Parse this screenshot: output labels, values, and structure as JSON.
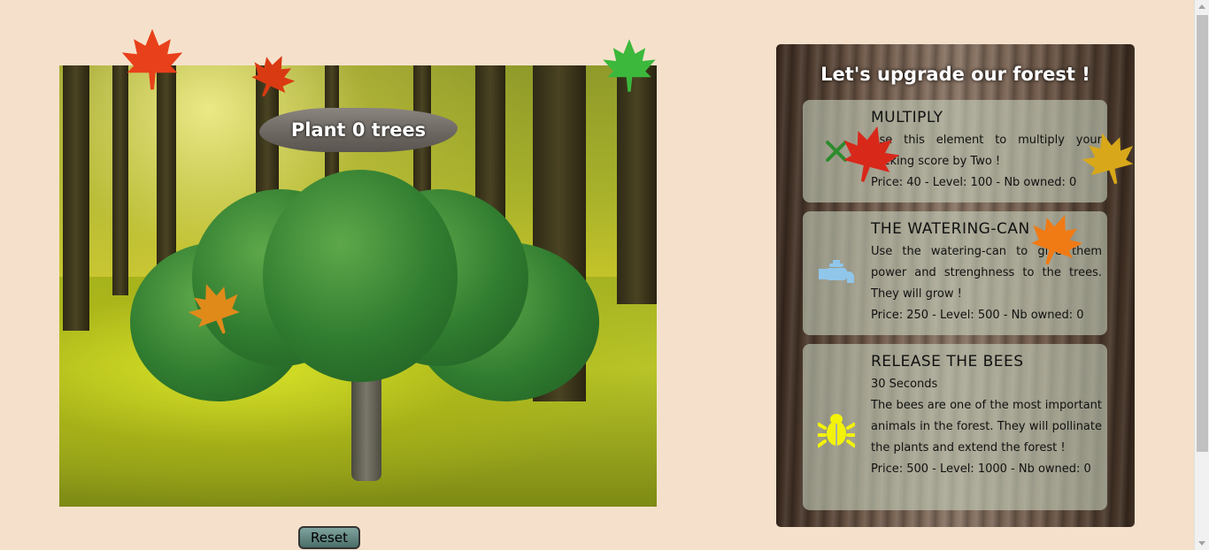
{
  "game": {
    "plant_sign": "Plant 0 trees",
    "reset_label": "Reset"
  },
  "shop": {
    "title": "Let's upgrade our forest !",
    "items": [
      {
        "name": "MULTIPLY",
        "icon": "x-icon",
        "description": "Use this element to multiply your clicking score by Two !",
        "meta": "Price: 40 - Level: 100 - Nb owned: 0"
      },
      {
        "name": "THE WATERING-CAN",
        "icon": "faucet-icon",
        "description": "Use the watering-can to give them power and strenghness to the trees. They will grow !",
        "meta": "Price: 250 - Level: 500 - Nb owned: 0"
      },
      {
        "name": "RELEASE THE BEES",
        "icon": "bug-icon",
        "subtitle": "30 Seconds",
        "description": "The bees are one of the most important animals in the forest. They will pollinate the plants and extend the forest !",
        "meta": "Price: 500 - Level: 1000 - Nb owned: 0"
      }
    ]
  },
  "colors": {
    "background": "#f5e1cb",
    "multiply_icon": "#2e8b2e",
    "faucet_icon": "#8fc6ea",
    "bug_icon": "#f2f20a"
  }
}
